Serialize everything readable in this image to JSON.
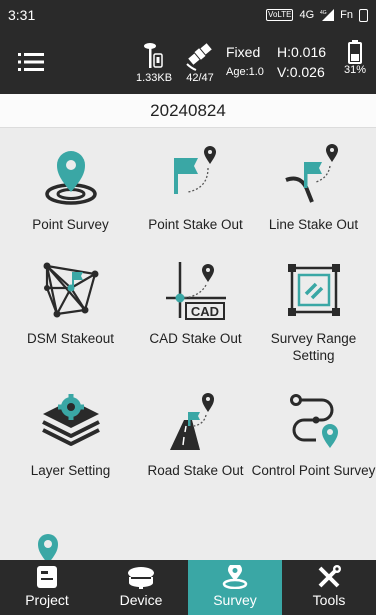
{
  "status_bar": {
    "time": "3:31",
    "volte": "VoLTE",
    "network": "4G",
    "network_small": "4G",
    "fn": "Fn"
  },
  "toolbar": {
    "data_rate": "1.33KB",
    "satellites": "42/47",
    "fix_status": "Fixed",
    "age": "Age:1.0",
    "h_precision": "H:0.016",
    "v_precision": "V:0.026",
    "battery": "31%"
  },
  "project": {
    "date": "20240824"
  },
  "tiles": [
    {
      "label": "Point Survey",
      "icon": "point-survey-icon"
    },
    {
      "label": "Point Stake Out",
      "icon": "point-stakeout-icon"
    },
    {
      "label": "Line Stake Out",
      "icon": "line-stakeout-icon"
    },
    {
      "label": "DSM Stakeout",
      "icon": "dsm-stakeout-icon"
    },
    {
      "label": "CAD Stake Out",
      "icon": "cad-stakeout-icon",
      "badge": "CAD"
    },
    {
      "label": "Survey Range Setting",
      "icon": "survey-range-icon"
    },
    {
      "label": "Layer Setting",
      "icon": "layer-setting-icon"
    },
    {
      "label": "Road Stake Out",
      "icon": "road-stakeout-icon"
    },
    {
      "label": "Control Point Survey",
      "icon": "control-point-icon"
    },
    {
      "label": "",
      "icon": "location-pin-icon"
    }
  ],
  "bottom_nav": [
    {
      "label": "Project",
      "icon": "project-icon",
      "active": false
    },
    {
      "label": "Device",
      "icon": "device-icon",
      "active": false
    },
    {
      "label": "Survey",
      "icon": "survey-icon",
      "active": true
    },
    {
      "label": "Tools",
      "icon": "tools-icon",
      "active": false
    }
  ],
  "colors": {
    "accent": "#3aa7a5",
    "dark": "#2a2a2a",
    "background": "#ececec"
  }
}
